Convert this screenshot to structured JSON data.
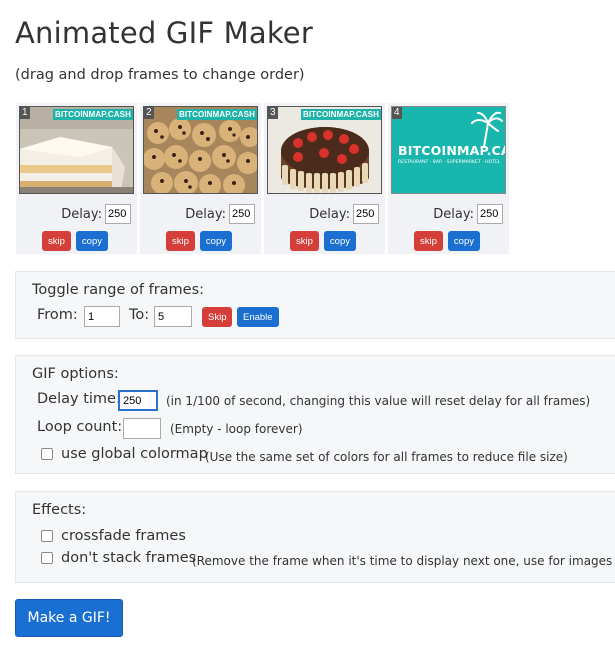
{
  "title": "Animated GIF Maker",
  "subtitle": "(drag and drop frames to change order)",
  "frames": [
    {
      "number": "1",
      "watermark": "BITCOINMAP.CASH",
      "delay_label": "Delay:",
      "delay": "250",
      "skip_label": "skip",
      "copy_label": "copy"
    },
    {
      "number": "2",
      "watermark": "BITCOINMAP.CASH",
      "delay_label": "Delay:",
      "delay": "250",
      "skip_label": "skip",
      "copy_label": "copy"
    },
    {
      "number": "3",
      "watermark": "BITCOINMAP.CASH",
      "delay_label": "Delay:",
      "delay": "250",
      "skip_label": "skip",
      "copy_label": "copy"
    },
    {
      "number": "4",
      "logo_text": "BITCOINMAP.CASH",
      "logo_tagline": "RESTAURANT · BAR · SUPERMARKET · HOTEL",
      "delay_label": "Delay:",
      "delay": "250",
      "skip_label": "skip",
      "copy_label": "copy"
    }
  ],
  "range": {
    "heading": "Toggle range of frames:",
    "from_label": "From:",
    "from_value": "1",
    "to_label": "To:",
    "to_value": "5",
    "skip_label": "Skip",
    "enable_label": "Enable"
  },
  "options": {
    "heading": "GIF options:",
    "delay_label": "Delay time:",
    "delay_value": "250",
    "delay_hint": "(in 1/100 of second, changing this value will reset delay for all frames)",
    "loop_label": "Loop count:",
    "loop_value": "",
    "loop_hint": "(Empty - loop forever)",
    "colormap_label": "use global colormap",
    "colormap_hint": "(Use the same set of colors for all frames to reduce file size)"
  },
  "effects": {
    "heading": "Effects:",
    "crossfade_label": "crossfade frames",
    "nostack_label": "don't stack frames",
    "nostack_hint": "(Remove the frame when it's time to display next one, use for images wi"
  },
  "make_button_label": "Make a GIF!",
  "colors": {
    "accent_blue": "#1b6fd1",
    "danger_red": "#d43f3a",
    "panel_bg": "#f5f7f9",
    "logo_teal": "#18b6ad"
  }
}
